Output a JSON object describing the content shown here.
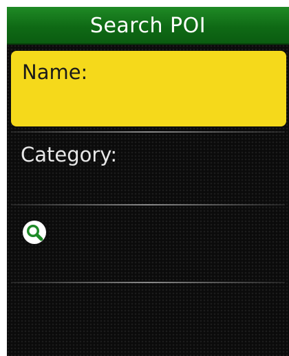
{
  "title": "Search POI",
  "fields": {
    "name_label": "Name:",
    "category_label": "Category:"
  },
  "search": {
    "icon": "search-icon"
  },
  "colors": {
    "title_bar": "#0f6a15",
    "selected_row": "#f5d91b",
    "background": "#0b0b0b",
    "text": "#e8e8e8"
  }
}
